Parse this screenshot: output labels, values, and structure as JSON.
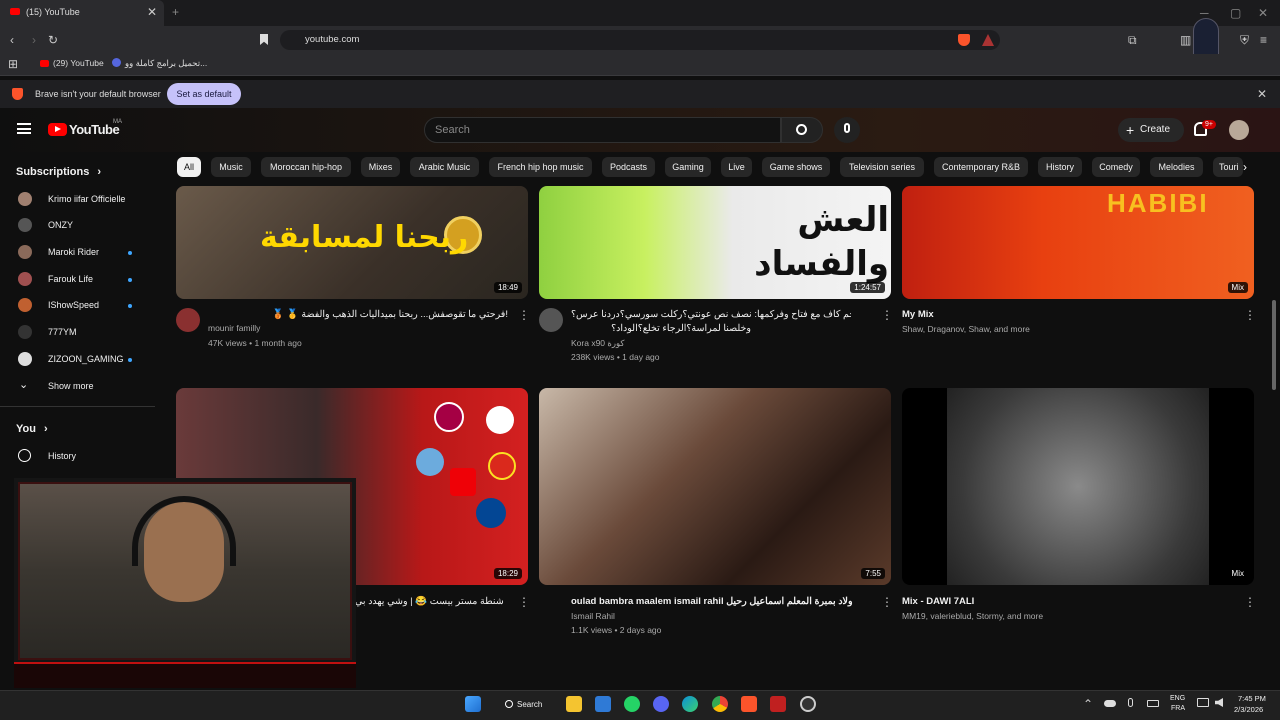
{
  "browser": {
    "tab_title": "(15) YouTube",
    "url": "youtube.com",
    "bookmarks": [
      "(29) YouTube",
      "تحميل برامج كاملة وو..."
    ],
    "infobar_text": "Brave isn't your default browser",
    "set_default_label": "Set as default"
  },
  "header": {
    "logo_text": "YouTube",
    "region": "MA",
    "search_placeholder": "Search",
    "create_label": "Create",
    "notif_badge": "9+"
  },
  "chips": [
    "All",
    "Music",
    "Moroccan hip-hop",
    "Mixes",
    "Arabic Music",
    "French hip hop music",
    "Podcasts",
    "Gaming",
    "Live",
    "Game shows",
    "Television series",
    "Contemporary R&B",
    "History",
    "Comedy",
    "Melodies",
    "Touri"
  ],
  "sidebar": {
    "subscriptions_label": "Subscriptions",
    "channels": [
      "Krimo iifar Officielle",
      "ONZY",
      "Maroki Rider",
      "Farouk Life",
      "IShowSpeed",
      "777YM",
      "ZIZOON_GAMING"
    ],
    "show_more": "Show more",
    "you_label": "You",
    "history_label": "History"
  },
  "videos": [
    {
      "title": "🥉 🥇 فرحتي ما تقوصفش... ربحنا بميداليات الذهب والفضة!",
      "channel": "mounir familly",
      "meta": "47K views • 1 month ago",
      "duration": "18:49",
      "thumb_text": "ربحنا لمسابقة"
    },
    {
      "title": "يورزوق هاجم كاف مع فتاح وفركمها: نصف نص عونتي؟ركلت سورسي؟دردنا عرس؟",
      "title2": "وخلصنا لمراسة؟الرجاء تخلع؟الوداد؟",
      "channel": "Kora x90 كورة",
      "meta": "238K views • 1 day ago",
      "duration": "1:24:57",
      "thumb_text": "العش والفساد"
    },
    {
      "title": "My Mix",
      "channel": "Shaw, Draganov, Shaw, and more",
      "meta": "",
      "duration": "Mix",
      "thumb_text": "HABIBI"
    },
    {
      "title": "قصة شنطة مستر بيست 😂 | وشي يهدد بي",
      "channel": "",
      "meta": "",
      "duration": "18:29",
      "thumb_text": ""
    },
    {
      "title": "oulad bambra maalem ismail rahil ولاد بمبرة المعلم اسماعيل رحيل",
      "channel": "Ismail Rahil",
      "meta": "1.1K views • 2 days ago",
      "duration": "7:55",
      "thumb_text": ""
    },
    {
      "title": "Mix - DAWI 7ALI",
      "channel": "MM19, valerieblud, Stormy, and more",
      "meta": "",
      "duration": "Mix",
      "thumb_text": ""
    }
  ],
  "taskbar": {
    "search_label": "Search",
    "lang1": "ENG",
    "lang2": "FRA",
    "time": "7:45 PM",
    "date": "2/3/2026"
  },
  "colors": {
    "accent": "#ff0000",
    "chip_active": "#f1f1f1",
    "set_default_bg": "#c6c2fa"
  }
}
